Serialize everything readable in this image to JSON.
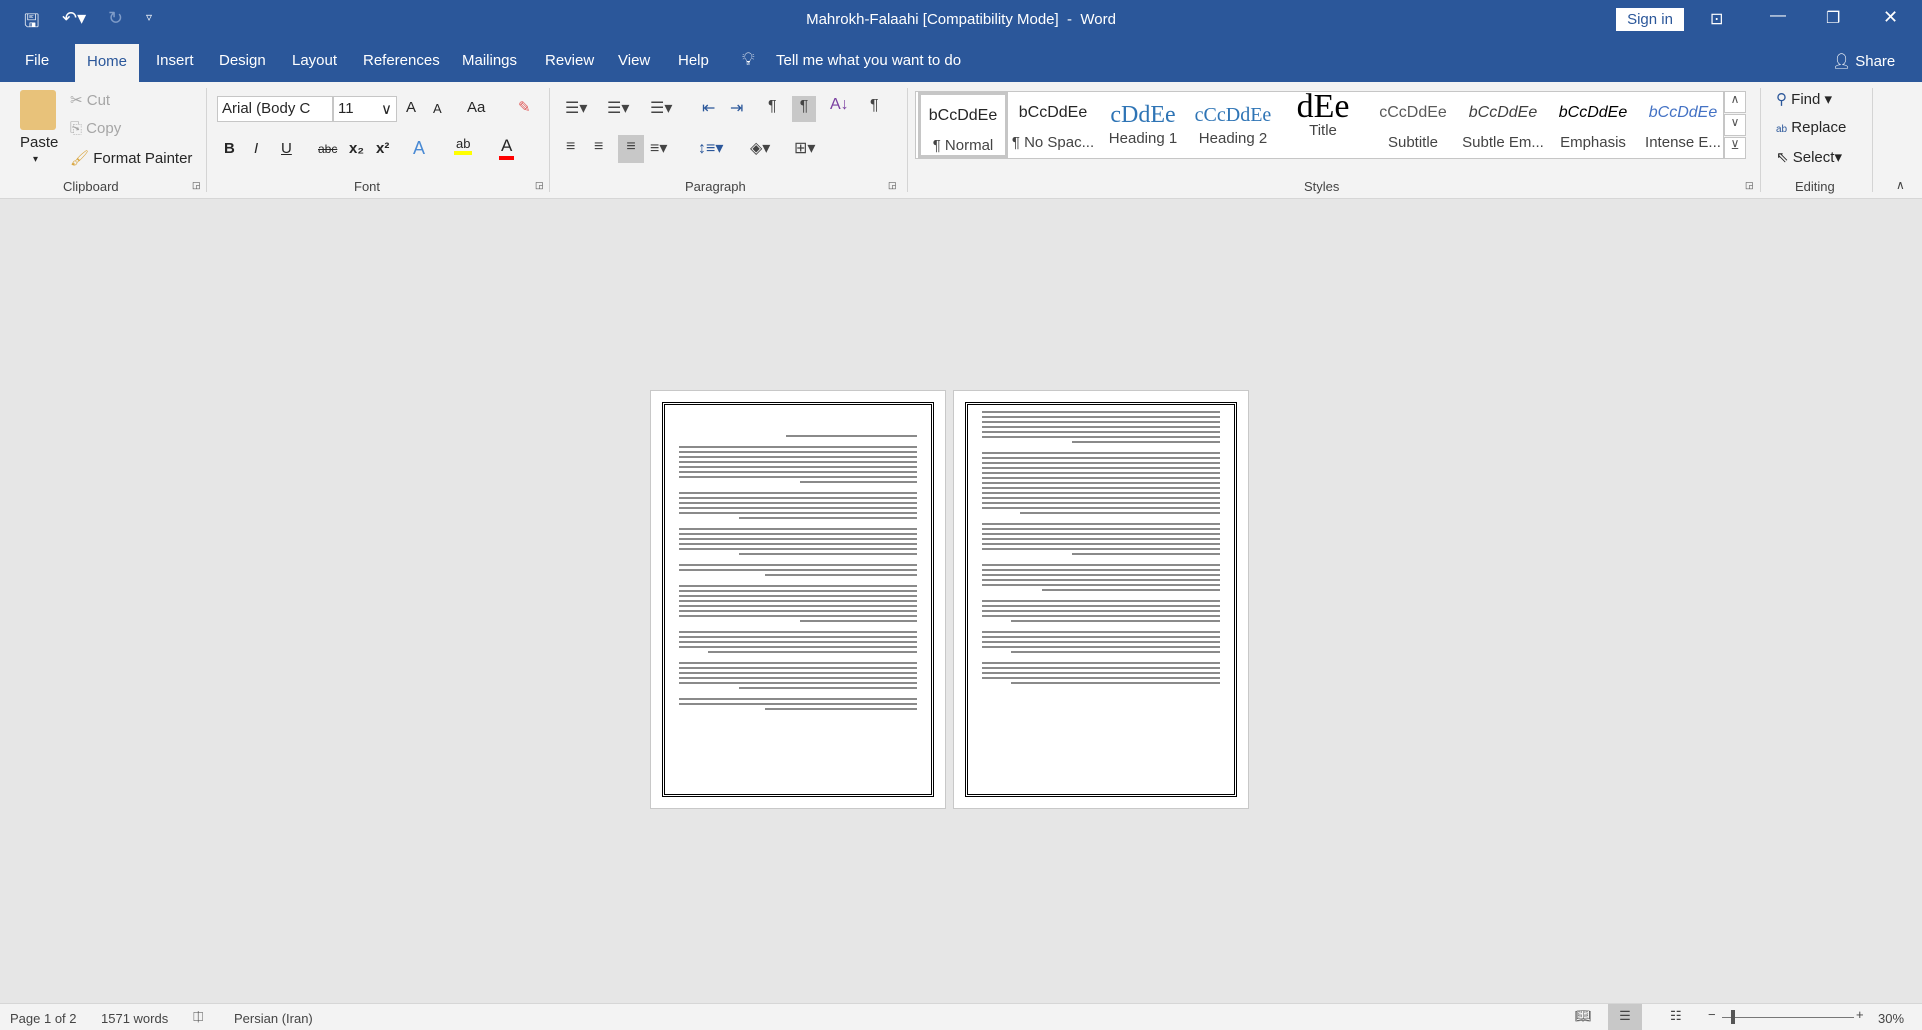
{
  "titlebar": {
    "title": "Mahrokh-Falaahi [Compatibility Mode]  -  Word",
    "sign_in": "Sign in",
    "icons": [
      "save-icon",
      "undo-icon",
      "redo-icon",
      "customize-qat-icon",
      "ribbon-display-icon",
      "minimize-icon",
      "restore-icon",
      "close-icon"
    ]
  },
  "tabs": [
    {
      "label": "File"
    },
    {
      "label": "Home",
      "active": true
    },
    {
      "label": "Insert"
    },
    {
      "label": "Design"
    },
    {
      "label": "Layout"
    },
    {
      "label": "References"
    },
    {
      "label": "Mailings"
    },
    {
      "label": "Review"
    },
    {
      "label": "View"
    },
    {
      "label": "Help"
    }
  ],
  "tell_me": "Tell me what you want to do",
  "share": "Share",
  "clipboard": {
    "label": "Clipboard",
    "paste": "Paste",
    "cut": "Cut",
    "copy": "Copy",
    "format_painter": "Format Painter"
  },
  "font": {
    "label": "Font",
    "family": "Arial (Body C",
    "size": "11",
    "bold": "B",
    "italic": "I",
    "underline": "U",
    "strike": "abc",
    "sub": "x₂",
    "sup": "x²",
    "grow": "A",
    "shrink": "A",
    "case": "Aa",
    "highlight_color": "#ffff00",
    "font_color": "#ff0000"
  },
  "paragraph": {
    "label": "Paragraph"
  },
  "styles": {
    "label": "Styles",
    "items": [
      {
        "preview": "bCcDdEe",
        "name": "¶ Normal",
        "selected": true
      },
      {
        "preview": "bCcDdEe",
        "name": "¶ No Spac..."
      },
      {
        "preview": "cDdEe",
        "name": "Heading 1"
      },
      {
        "preview": "cCcDdEe",
        "name": "Heading 2"
      },
      {
        "preview": "dEe",
        "name": "Title"
      },
      {
        "preview": "cCcDdEe",
        "name": "Subtitle"
      },
      {
        "preview": "bCcDdEe",
        "name": "Subtle Em..."
      },
      {
        "preview": "bCcDdEe",
        "name": "Emphasis"
      },
      {
        "preview": "bCcDdEe",
        "name": "Intense E..."
      }
    ]
  },
  "editing": {
    "label": "Editing",
    "find": "Find",
    "replace": "Replace",
    "select": "Select"
  },
  "status": {
    "page": "Page 1 of 2",
    "words": "1571 words",
    "language": "Persian (Iran)",
    "zoom": "30%",
    "zoom_value": 30
  }
}
